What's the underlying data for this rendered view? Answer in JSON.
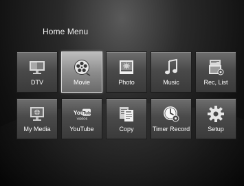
{
  "menu": {
    "title": "Home Menu",
    "items": [
      {
        "label": "DTV",
        "icon": "tv-icon"
      },
      {
        "label": "Movie",
        "icon": "film-reel-icon"
      },
      {
        "label": "Photo",
        "icon": "photo-icon"
      },
      {
        "label": "Music",
        "icon": "music-note-icon"
      },
      {
        "label": "Rec, List",
        "icon": "recording-list-icon"
      },
      {
        "label": "My Media",
        "icon": "media-globe-icon"
      },
      {
        "label": "YouTube",
        "icon": "youtube-logo-icon"
      },
      {
        "label": "Copy",
        "icon": "copy-documents-icon"
      },
      {
        "label": "Timer Record",
        "icon": "timer-clock-icon"
      },
      {
        "label": "Setup",
        "icon": "gear-icon"
      }
    ],
    "selected": "Movie"
  },
  "youtube_logo": {
    "you": "You",
    "tube": "Tube",
    "sub": "VIDEOS"
  }
}
